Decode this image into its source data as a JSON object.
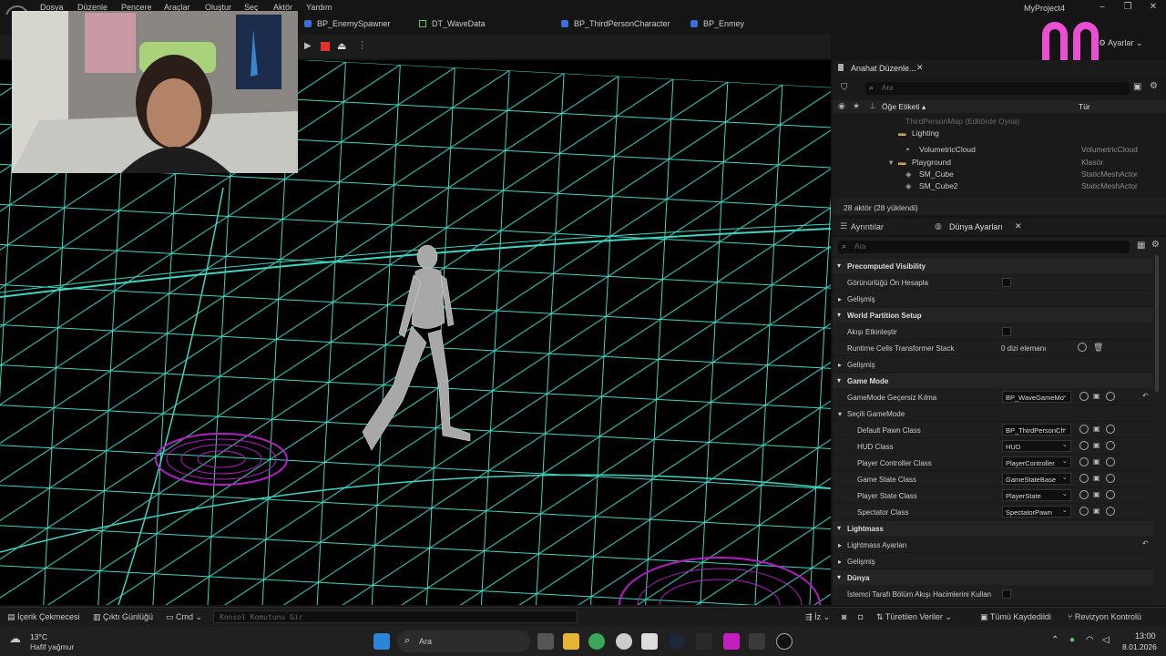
{
  "menu": [
    "Dosya",
    "Düzenle",
    "Pencere",
    "Araçlar",
    "Oluştur",
    "Seç",
    "Aktör",
    "Yardım"
  ],
  "project_title": "MyProject4",
  "tabs": [
    "BP_EnemySpawner",
    "DT_WaveData",
    "BP_ThirdPersonCharacter",
    "BP_Enmey"
  ],
  "settings_label": "Ayarlar",
  "outliner": {
    "tab_title": "Anahat Düzenle...",
    "search_placeholder": "Ara",
    "col_label": "Öğe Etiketi",
    "col_type": "Tür",
    "rows": [
      {
        "name": "ThirdPersonMap (Editörde Oyna)",
        "type": ""
      },
      {
        "name": "Lighting",
        "type": ""
      },
      {
        "name": "VolumetricCloud",
        "type": "VolumetricCloud"
      },
      {
        "name": "Playground",
        "type": "Klasör"
      },
      {
        "name": "SM_Cube",
        "type": "StaticMeshActor"
      },
      {
        "name": "SM_Cube2",
        "type": "StaticMeshActor"
      }
    ],
    "footer": "28 aktör (28 yüklendi)"
  },
  "details": {
    "tab_details": "Ayrıntılar",
    "tab_world": "Dünya Ayarları",
    "search_placeholder": "Ara",
    "sec_precomputed": "Precomputed Visibility",
    "precompute_label": "Görünürlüğü Ön Hesapla",
    "advanced": "Gelişmiş",
    "sec_world_partition": "World Partition Setup",
    "enable_streaming": "Akışı Etkinleştir",
    "runtime_cells": "Runtime Cells Transformer Stack",
    "array_elements": "0 dizi elemanı",
    "sec_game_mode": "Game Mode",
    "gamemode_override": "GameMode Geçersiz Kılma",
    "gamemode_value": "BP_WaveGameMo",
    "selected_gamemode": "Seçili GameMode",
    "classes": [
      {
        "label": "Default Pawn Class",
        "value": "BP_ThirdPersonCh"
      },
      {
        "label": "HUD Class",
        "value": "HUD"
      },
      {
        "label": "Player Controller Class",
        "value": "PlayerController"
      },
      {
        "label": "Game State Class",
        "value": "GameStateBase"
      },
      {
        "label": "Player State Class",
        "value": "PlayerState"
      },
      {
        "label": "Spectator Class",
        "value": "SpectatorPawn"
      }
    ],
    "sec_lightmass": "Lightmass",
    "lightmass_settings": "Lightmass Ayarları",
    "sec_world": "Dünya",
    "client_side": "İstemci Tarafı Bölüm Akışı Hacimlerini Kullan"
  },
  "statusbar": {
    "content_drawer": "İçerik Çekmecesi",
    "output_log": "Çıktı Günlüğü",
    "cmd": "Cmd",
    "console_placeholder": "Konsol Komutunu Gir",
    "trace": "İz",
    "derived_data": "Türetilen Veriler",
    "all_saved": "Tümü Kaydedildi",
    "revision": "Revizyon Kontrolü"
  },
  "taskbar": {
    "temp": "13°C",
    "weather": "Hafif yağmur",
    "search": "Ara",
    "time": "13:00",
    "date": "8.01.2026"
  },
  "colors": {
    "grid": "#3fd6c3",
    "ring": "#b21fc2",
    "accent": "#e94fd0"
  }
}
